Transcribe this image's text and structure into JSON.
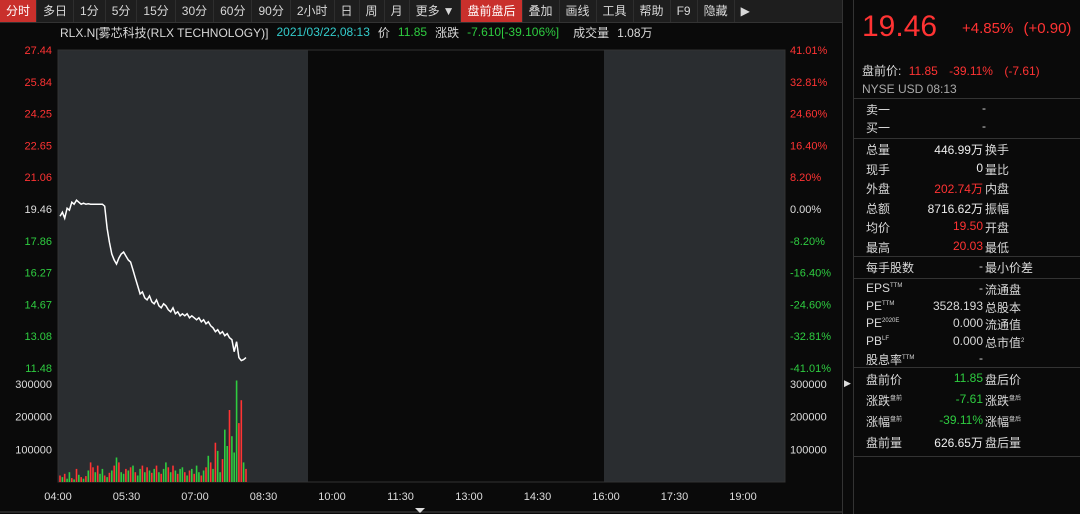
{
  "toolbar": {
    "tabs": [
      "分时",
      "多日",
      "1分",
      "5分",
      "15分",
      "30分",
      "60分",
      "90分",
      "2小时",
      "日",
      "周",
      "月",
      "更多"
    ],
    "more_arrow": "▼",
    "extra": [
      "盘前盘后",
      "叠加",
      "画线",
      "工具",
      "帮助",
      "F9",
      "隐藏"
    ],
    "hide_arrow": "▶"
  },
  "info": {
    "symbol": "RLX.N[雾芯科技(RLX TECHNOLOGY)]",
    "datetime": "2021/03/22,08:13",
    "price_label": "价",
    "price": "11.85",
    "change_label": "涨跌",
    "change": "-7.610[-39.106%]",
    "volume_label": "成交量",
    "volume": "1.08万"
  },
  "chart_data": {
    "type": "line",
    "price_ticks": [
      "27.44",
      "25.84",
      "24.25",
      "22.65",
      "21.06",
      "19.46",
      "17.86",
      "16.27",
      "14.67",
      "13.08",
      "11.48"
    ],
    "pct_ticks": [
      "41.01%",
      "32.81%",
      "24.60%",
      "16.40%",
      "8.20%",
      "0.00%",
      "-8.20%",
      "-16.40%",
      "-24.60%",
      "-32.81%",
      "-41.01%"
    ],
    "volume_ticks": [
      "300000",
      "200000",
      "100000"
    ],
    "time_ticks": [
      "04:00",
      "05:30",
      "07:00",
      "08:30",
      "10:00",
      "11:30",
      "13:00",
      "14:30",
      "16:00",
      "17:30",
      "19:00"
    ],
    "ylim": [
      11.48,
      27.44
    ],
    "prev_close": 19.46,
    "price": [
      19.1,
      19.3,
      19.0,
      19.5,
      19.4,
      19.8,
      19.7,
      19.9,
      19.8,
      19.7,
      19.75,
      19.7,
      19.72,
      19.7,
      19.7,
      19.7,
      19.7,
      19.7,
      19.7,
      19.6,
      18.5,
      17.8,
      17.2,
      16.9,
      16.7,
      17.0,
      17.2,
      17.3,
      17.1,
      16.9,
      16.8,
      16.4,
      16.0,
      15.6,
      15.2,
      15.3,
      15.0,
      14.9,
      15.1,
      14.8,
      14.7,
      14.9,
      14.6,
      14.5,
      14.7,
      14.6,
      14.4,
      14.3,
      14.5,
      14.2,
      14.3,
      14.1,
      14.2,
      14.1,
      14.2,
      14.0,
      14.1,
      14.0,
      13.9,
      14.0,
      13.8,
      13.9,
      13.7,
      13.8,
      13.6,
      13.5,
      13.3,
      13.4,
      13.2,
      13.3,
      13.1,
      13.2,
      13.0,
      12.9,
      12.3,
      12.8,
      12.0,
      11.85,
      11.9,
      12.0
    ],
    "volume_max": 330000,
    "volume": [
      20000,
      15000,
      25000,
      10000,
      30000,
      12000,
      8000,
      40000,
      22000,
      15000,
      10000,
      18000,
      35000,
      60000,
      45000,
      30000,
      50000,
      25000,
      40000,
      20000,
      15000,
      28000,
      35000,
      50000,
      75000,
      60000,
      30000,
      25000,
      40000,
      35000,
      45000,
      50000,
      30000,
      20000,
      40000,
      50000,
      30000,
      45000,
      35000,
      28000,
      40000,
      50000,
      30000,
      25000,
      40000,
      60000,
      45000,
      30000,
      50000,
      35000,
      25000,
      40000,
      45000,
      30000,
      20000,
      35000,
      40000,
      25000,
      50000,
      30000,
      20000,
      35000,
      45000,
      80000,
      60000,
      40000,
      120000,
      95000,
      30000,
      70000,
      160000,
      110000,
      220000,
      140000,
      90000,
      310000,
      180000,
      250000,
      60000,
      40000
    ],
    "volume_colors": [
      "r",
      "g",
      "r",
      "g",
      "g",
      "r",
      "g",
      "r",
      "g",
      "r",
      "g",
      "r",
      "g",
      "r",
      "r",
      "g",
      "r",
      "g",
      "g",
      "r",
      "g",
      "r",
      "g",
      "r",
      "g",
      "r",
      "g",
      "g",
      "r",
      "g",
      "r",
      "g",
      "r",
      "g",
      "g",
      "r",
      "g",
      "r",
      "g",
      "r",
      "g",
      "r",
      "g",
      "r",
      "g",
      "g",
      "r",
      "g",
      "r",
      "g",
      "r",
      "g",
      "g",
      "r",
      "g",
      "r",
      "g",
      "r",
      "g",
      "g",
      "r",
      "g",
      "r",
      "g",
      "r",
      "g",
      "r",
      "g",
      "g",
      "r",
      "g",
      "g",
      "r",
      "g",
      "g",
      "g",
      "r",
      "r",
      "g",
      "r"
    ]
  },
  "panel": {
    "price": "19.46",
    "change_pct": "+4.85%",
    "change_abs": "(+0.90)",
    "pre_label": "盘前价:",
    "pre_price": "11.85",
    "pre_pct": "-39.11%",
    "pre_abs": "(-7.61)",
    "exchange": "NYSE  USD  08:13",
    "sell1_label": "卖一",
    "sell1_value": "-",
    "buy1_label": "买一",
    "buy1_value": "-",
    "stats": [
      {
        "l": "总量",
        "v": "446.99万",
        "r": "换手",
        "c": "white"
      },
      {
        "l": "现手",
        "v": "0",
        "r": "量比",
        "c": "white"
      },
      {
        "l": "外盘",
        "v": "202.74万",
        "r": "内盘",
        "c": "red"
      },
      {
        "l": "总额",
        "v": "8716.62万",
        "r": "振幅",
        "c": "white"
      },
      {
        "l": "均价",
        "v": "19.50",
        "r": "开盘",
        "c": "red"
      },
      {
        "l": "最高",
        "v": "20.03",
        "r": "最低",
        "c": "red"
      }
    ],
    "lot_label": "每手股数",
    "lot_value": "-",
    "min_spread_label": "最小价差",
    "fund": [
      {
        "l": "EPS",
        "sup": "TTM",
        "v": "-",
        "r": "流通盘",
        "rsup": ""
      },
      {
        "l": "PE",
        "sup": "TTM",
        "v": "3528.193",
        "r": "总股本",
        "rsup": ""
      },
      {
        "l": "PE",
        "sup": "2020E",
        "v": "0.000",
        "r": "流通值",
        "rsup": ""
      },
      {
        "l": "PB",
        "sup": "LF",
        "v": "0.000",
        "r": "总市值",
        "rsup": "2"
      },
      {
        "l": "股息率",
        "sup": "TTM",
        "v": "-",
        "r": "",
        "rsup": ""
      }
    ],
    "pre_stats": [
      {
        "l": "盘前价",
        "lsup": "",
        "v": "11.85",
        "r": "盘后价",
        "rsup": "",
        "c": "green"
      },
      {
        "l": "涨跌",
        "lsup": "盘前",
        "v": "-7.61",
        "r": "涨跌",
        "rsup": "盘后",
        "c": "green"
      },
      {
        "l": "涨幅",
        "lsup": "盘前",
        "v": "-39.11%",
        "r": "涨幅",
        "rsup": "盘后",
        "c": "green"
      },
      {
        "l": "盘前量",
        "lsup": "",
        "v": "626.65万",
        "r": "盘后量",
        "rsup": "",
        "c": "white"
      }
    ],
    "expand_arrow": "▶"
  },
  "colors": {
    "up": "#ff3333",
    "down": "#2ecc40",
    "line": "#ffffff",
    "shade": "#2a2d30"
  }
}
